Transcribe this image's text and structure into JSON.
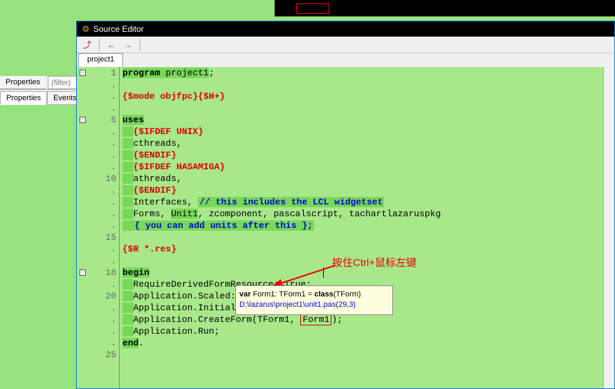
{
  "window": {
    "title": "Source Editor"
  },
  "leftPanel": {
    "topTab": "Properties",
    "filterPlaceholder": "(filter)",
    "bottomTabs": [
      "Properties",
      "Events"
    ]
  },
  "fileTab": "project1",
  "gutter": {
    "lines": [
      "1",
      ".",
      ".",
      ".",
      "5",
      ".",
      ".",
      ".",
      ".",
      "10",
      ".",
      ".",
      ".",
      ".",
      "15",
      ".",
      ".",
      "18",
      ".",
      "20",
      ".",
      ".",
      ".",
      ".",
      "25",
      ""
    ]
  },
  "code": {
    "l1_kw": "program",
    "l1_id": " project1",
    "l1_semi": ";",
    "l3": "{$mode objfpc}{$H+}",
    "l5": "uses",
    "l6": "{$IFDEF UNIX}",
    "l7": "cthreads,",
    "l8": "{$ENDIF}",
    "l9": "{$IFDEF HASAMIGA}",
    "l10": "athreads,",
    "l11": "{$ENDIF}",
    "l12a": "Interfaces, ",
    "l12b": "// this includes the LCL widgetset",
    "l13a": "Forms, ",
    "l13b": "Unit1",
    "l13c": ", zcomponent, pascalscript, tachartlazaruspkg",
    "l14": "{ you can add units after this };",
    "l16": "{$R *.res}",
    "l18": "begin",
    "l19": "RequireDerivedFormResource:=True;",
    "l20": "Application.Scaled:=True;",
    "l21": "Application.Initialize;",
    "l22a": "Application.CreateForm(TForm1, ",
    "l22b": "Form1",
    "l22c": ");",
    "l23": "Application.Run;",
    "l24": "end",
    "l24b": "."
  },
  "tooltip": {
    "line1_a": "var",
    "line1_b": " Form1: TForm1 = ",
    "line1_c": "class",
    "line1_d": "(TForm)",
    "line2": "D:\\lazarus\\project1\\unit1.pas(29,3)"
  },
  "annotation": "按住Ctrl+鼠标左键"
}
